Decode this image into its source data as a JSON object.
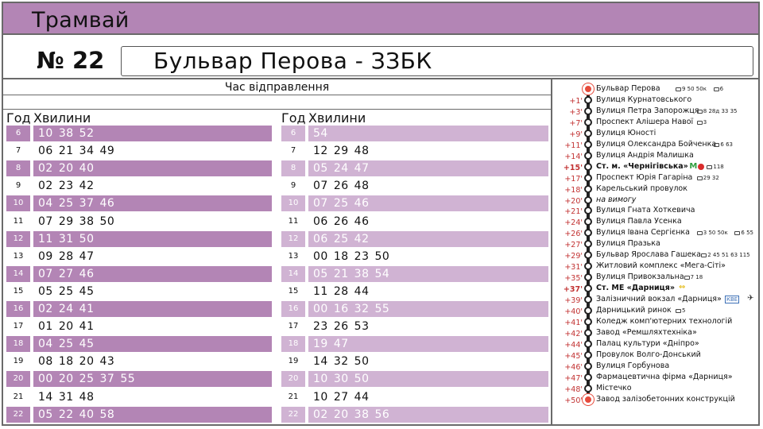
{
  "header": {
    "vehicle_type": "Трамвай",
    "route_number": "№ 22",
    "route_name": "Бульвар Перова - ЗЗБК"
  },
  "timetable": {
    "title": "Час відправлення",
    "hour_label": "Год",
    "minutes_label": "Хвилини",
    "left": [
      {
        "hour": "6",
        "minutes": [
          "10",
          "38",
          "52"
        ]
      },
      {
        "hour": "7",
        "minutes": [
          "06",
          "21",
          "34",
          "49"
        ]
      },
      {
        "hour": "8",
        "minutes": [
          "02",
          "20",
          "40"
        ]
      },
      {
        "hour": "9",
        "minutes": [
          "02",
          "23",
          "42"
        ]
      },
      {
        "hour": "10",
        "minutes": [
          "04",
          "25",
          "37",
          "46"
        ]
      },
      {
        "hour": "11",
        "minutes": [
          "07",
          "29",
          "38",
          "50"
        ]
      },
      {
        "hour": "12",
        "minutes": [
          "11",
          "31",
          "50"
        ]
      },
      {
        "hour": "13",
        "minutes": [
          "09",
          "28",
          "47"
        ]
      },
      {
        "hour": "14",
        "minutes": [
          "07",
          "27",
          "46"
        ]
      },
      {
        "hour": "15",
        "minutes": [
          "05",
          "25",
          "45"
        ]
      },
      {
        "hour": "16",
        "minutes": [
          "02",
          "24",
          "41"
        ]
      },
      {
        "hour": "17",
        "minutes": [
          "01",
          "20",
          "41"
        ]
      },
      {
        "hour": "18",
        "minutes": [
          "04",
          "25",
          "45"
        ]
      },
      {
        "hour": "19",
        "minutes": [
          "08",
          "18",
          "20",
          "43"
        ]
      },
      {
        "hour": "20",
        "minutes": [
          "00",
          "20",
          "25",
          "37",
          "55"
        ]
      },
      {
        "hour": "21",
        "minutes": [
          "14",
          "31",
          "48"
        ]
      },
      {
        "hour": "22",
        "minutes": [
          "05",
          "22",
          "40",
          "58"
        ]
      }
    ],
    "right": [
      {
        "hour": "6",
        "minutes": [
          "54"
        ]
      },
      {
        "hour": "7",
        "minutes": [
          "12",
          "29",
          "48"
        ]
      },
      {
        "hour": "8",
        "minutes": [
          "05",
          "24",
          "47"
        ]
      },
      {
        "hour": "9",
        "minutes": [
          "07",
          "26",
          "48"
        ]
      },
      {
        "hour": "10",
        "minutes": [
          "07",
          "25",
          "46"
        ]
      },
      {
        "hour": "11",
        "minutes": [
          "06",
          "26",
          "46"
        ]
      },
      {
        "hour": "12",
        "minutes": [
          "06",
          "25",
          "42"
        ]
      },
      {
        "hour": "13",
        "minutes": [
          "00",
          "18",
          "23",
          "50"
        ]
      },
      {
        "hour": "14",
        "minutes": [
          "05",
          "21",
          "38",
          "54"
        ]
      },
      {
        "hour": "15",
        "minutes": [
          "11",
          "28",
          "44"
        ]
      },
      {
        "hour": "16",
        "minutes": [
          "00",
          "16",
          "32",
          "55"
        ]
      },
      {
        "hour": "17",
        "minutes": [
          "23",
          "26",
          "53"
        ]
      },
      {
        "hour": "18",
        "minutes": [
          "19",
          "47"
        ]
      },
      {
        "hour": "19",
        "minutes": [
          "14",
          "32",
          "50"
        ]
      },
      {
        "hour": "20",
        "minutes": [
          "10",
          "30",
          "50"
        ]
      },
      {
        "hour": "21",
        "minutes": [
          "10",
          "27",
          "44"
        ]
      },
      {
        "hour": "22",
        "minutes": [
          "02",
          "20",
          "38",
          "56"
        ]
      }
    ]
  },
  "stops": [
    {
      "offset": "",
      "name": "Бульвар Перова",
      "terminal": true,
      "transfers": [
        "9 50 50к",
        "6"
      ]
    },
    {
      "offset": "+1'",
      "name": "Вулиця Курнатовського",
      "transfers": []
    },
    {
      "offset": "+3'",
      "name": "Вулиця Петра Запорожця",
      "transfers": [
        "8 28д 33 35"
      ]
    },
    {
      "offset": "+7'",
      "name": "Проспект Алішера Навої",
      "transfers": [
        "3"
      ]
    },
    {
      "offset": "+9'",
      "name": "Вулиця Юності",
      "transfers": []
    },
    {
      "offset": "+11'",
      "name": "Вулиця Олександра Бойченка",
      "transfers": [
        "6 63"
      ]
    },
    {
      "offset": "+14'",
      "name": "Вулиця Андрія Малишка",
      "transfers": []
    },
    {
      "offset": "+15'",
      "name": "Ст. м. «Чернігівська»",
      "bold": true,
      "metro": true,
      "transfers": [
        "118"
      ]
    },
    {
      "offset": "+17'",
      "name": "Проспект Юрія Гагаріна",
      "transfers": [
        "29 32"
      ]
    },
    {
      "offset": "+18'",
      "name": "Карельський провулок",
      "transfers": []
    },
    {
      "offset": "+20'",
      "name": "на вимогу",
      "italic": true,
      "transfers": []
    },
    {
      "offset": "+21'",
      "name": "Вулиця Гната Хоткевича",
      "transfers": []
    },
    {
      "offset": "+24'",
      "name": "Вулиця Павла Усенка",
      "transfers": []
    },
    {
      "offset": "+26'",
      "name": "Вулиця Івана Сергієнка",
      "transfers": [
        "3 50 50к",
        "6 55"
      ]
    },
    {
      "offset": "+27'",
      "name": "Вулиця Празька",
      "transfers": []
    },
    {
      "offset": "+29'",
      "name": "Бульвар Ярослава Гашека",
      "transfers": [
        "2 45 51 63 115"
      ]
    },
    {
      "offset": "+31'",
      "name": "Житловий комплекс «Мега-Сіті»",
      "transfers": []
    },
    {
      "offset": "+35'",
      "name": "Вулиця Привокзальна",
      "transfers": [
        "7 18"
      ]
    },
    {
      "offset": "+37'",
      "name": "Ст. МЕ «Дарниця»",
      "bold": true,
      "rail": true,
      "transfers": []
    },
    {
      "offset": "+39'",
      "name": "Залізничний вокзал «Дарниця»",
      "kbe": "КВЕ",
      "transfers": []
    },
    {
      "offset": "+40'",
      "name": "Дарницький ринок",
      "transfers": [
        "5"
      ]
    },
    {
      "offset": "+41'",
      "name": "Коледж комп'ютерних технологій",
      "transfers": []
    },
    {
      "offset": "+42'",
      "name": "Завод «Ремшляхтехніка»",
      "transfers": []
    },
    {
      "offset": "+44'",
      "name": "Палац культури «Дніпро»",
      "transfers": []
    },
    {
      "offset": "+45'",
      "name": "Провулок Волго-Донський",
      "transfers": []
    },
    {
      "offset": "+46'",
      "name": "Вулиця Горбунова",
      "transfers": []
    },
    {
      "offset": "+47'",
      "name": "Фармацевтична фірма «Дарниця»",
      "transfers": []
    },
    {
      "offset": "+48'",
      "name": "Містечко",
      "transfers": []
    },
    {
      "offset": "+50'",
      "name": "Завод залізобетонних конструкцій",
      "terminal": true,
      "transfers": []
    }
  ],
  "colors": {
    "band": "#b385b5",
    "row_alt_left": "#b385b5",
    "row_alt_right": "#d0b3d3",
    "offset_text": "#c23232",
    "terminal_dot": "#e64b3c"
  }
}
